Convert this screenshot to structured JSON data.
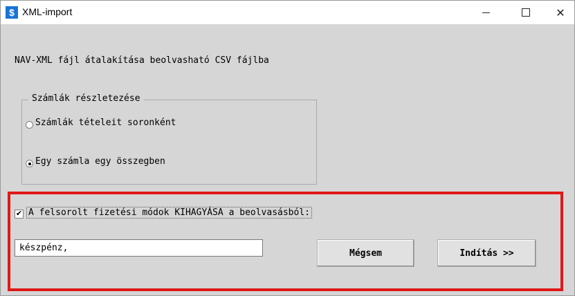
{
  "window": {
    "title": "XML-import",
    "icon_glyph": "$",
    "controls": {
      "minimize": "minimize-icon",
      "maximize": "maximize-icon",
      "close_glyph": "✕"
    }
  },
  "heading": "NAV-XML fájl átalakítása beolvasható CSV fájlba",
  "group": {
    "label": "Számlák részletezése",
    "options": [
      {
        "label": "Számlák tételeit soronként",
        "selected": false
      },
      {
        "label": "Egy számla egy összegben",
        "selected": true
      }
    ]
  },
  "skip": {
    "checked": true,
    "check_glyph": "✔",
    "label": "A felsorolt fizetési módok KIHAGYÁSA a beolvasásból:",
    "value": "készpénz,"
  },
  "buttons": {
    "cancel": "Mégsem",
    "start": "Indítás >>"
  },
  "colors": {
    "highlight_frame": "#e01818",
    "app_icon": "#1874d6",
    "dialog_bg": "#d6d6d6"
  }
}
